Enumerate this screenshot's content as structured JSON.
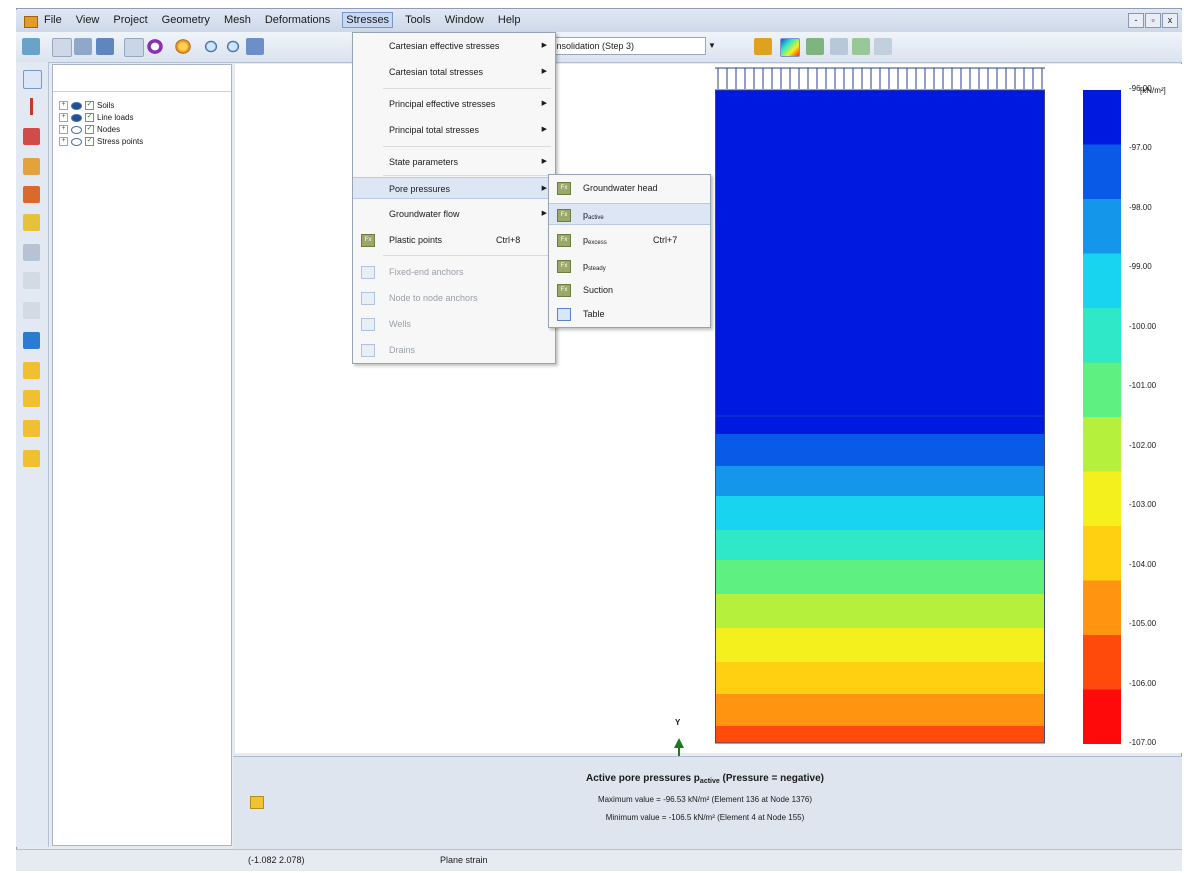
{
  "menubar": {
    "items": [
      "File",
      "View",
      "Project",
      "Geometry",
      "Mesh",
      "Deformations",
      "Stresses",
      "Tools",
      "Window",
      "Help"
    ],
    "open_item": "Stresses"
  },
  "window_controls": [
    "-",
    "▫",
    "x"
  ],
  "toolbar": {
    "phase_select": "Consolidation (Step 3)"
  },
  "model_tree": {
    "items": [
      {
        "label": "Soils",
        "visible": true
      },
      {
        "label": "Line loads",
        "visible": true
      },
      {
        "label": "Nodes",
        "visible": false
      },
      {
        "label": "Stress points",
        "visible": false
      }
    ]
  },
  "stresses_menu": {
    "items": [
      {
        "label": "Cartesian effective stresses",
        "submenu": true
      },
      {
        "label": "Cartesian total stresses",
        "submenu": true
      },
      {
        "label": "Principal effective stresses",
        "submenu": true
      },
      {
        "label": "Principal total stresses",
        "submenu": true
      },
      {
        "label": "State parameters",
        "submenu": true
      },
      {
        "label": "Pore pressures",
        "submenu": true,
        "highlighted": true
      },
      {
        "label": "Groundwater flow",
        "submenu": true
      },
      {
        "label": "Plastic points",
        "shortcut": "Ctrl+8",
        "icon": true
      },
      {
        "label": "Fixed-end anchors",
        "disabled": true
      },
      {
        "label": "Node to node anchors",
        "disabled": true
      },
      {
        "label": "Wells",
        "disabled": true
      },
      {
        "label": "Drains",
        "disabled": true
      }
    ]
  },
  "pore_pressures_submenu": {
    "items": [
      {
        "label": "Groundwater head",
        "icon": "contour"
      },
      {
        "label": "p",
        "subscript": "active",
        "icon": "contour",
        "highlighted": true
      },
      {
        "label": "p",
        "subscript": "excess",
        "shortcut": "Ctrl+7",
        "icon": "contour"
      },
      {
        "label": "p",
        "subscript": "steady",
        "icon": "contour"
      },
      {
        "label": "Suction",
        "icon": "contour"
      },
      {
        "label": "Table",
        "icon": "table"
      }
    ]
  },
  "legend": {
    "unit": "[kN/m²]",
    "ticks": [
      "-96.00",
      "-97.00",
      "-98.00",
      "-99.00",
      "-100.00",
      "-101.00",
      "-102.00",
      "-103.00",
      "-104.00",
      "-105.00",
      "-106.00",
      "-107.00"
    ],
    "colors": [
      "#0019e0",
      "#0a5ae8",
      "#1497ea",
      "#18d4ee",
      "#2ee8c8",
      "#5ef080",
      "#b4f03c",
      "#f4f01e",
      "#ffd012",
      "#ff9410",
      "#ff4a0c",
      "#ff0a0a"
    ]
  },
  "axis": {
    "y_label": "Y"
  },
  "info": {
    "title": "Active pore pressures p",
    "title_sub": "active",
    "title_suffix": " (Pressure = negative)",
    "max_line": "Maximum value = -96.53 kN/m² (Element 136 at Node 1376)",
    "min_line": "Minimum value = -106.5 kN/m² (Element 4 at Node 155)"
  },
  "status": {
    "coords": "(-1.082 2.078)",
    "mode": "Plane strain"
  },
  "colors": {
    "accent": "#1e4f98",
    "axis_arrow": "#1c7a1c"
  }
}
